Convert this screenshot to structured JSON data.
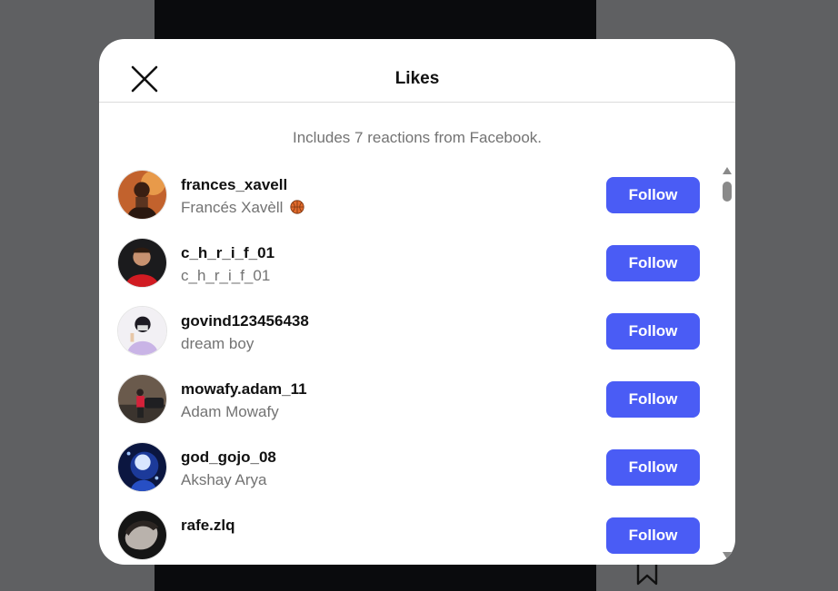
{
  "modal": {
    "title": "Likes",
    "notice": "Includes 7 reactions from Facebook."
  },
  "likes": [
    {
      "username": "frances_xavell",
      "fullname": "Francés Xavèll",
      "fullname_emoji": "basketball-icon",
      "follow_label": "Follow"
    },
    {
      "username": "c_h_r_i_f_01",
      "fullname": "c_h_r_i_f_01",
      "follow_label": "Follow"
    },
    {
      "username": "govind123456438",
      "fullname": "dream boy",
      "follow_label": "Follow"
    },
    {
      "username": "mowafy.adam_11",
      "fullname": "Adam Mowafy",
      "follow_label": "Follow"
    },
    {
      "username": "god_gojo_08",
      "fullname": "Akshay Arya",
      "follow_label": "Follow"
    },
    {
      "username": "rafe.zlq",
      "fullname": "",
      "follow_label": "Follow"
    }
  ],
  "colors": {
    "follow_button": "#4a5cf5",
    "overlay": "#5f6062",
    "secondary_text": "#737373"
  },
  "icons": {
    "close": "close-icon",
    "bookmark": "bookmark-icon"
  }
}
